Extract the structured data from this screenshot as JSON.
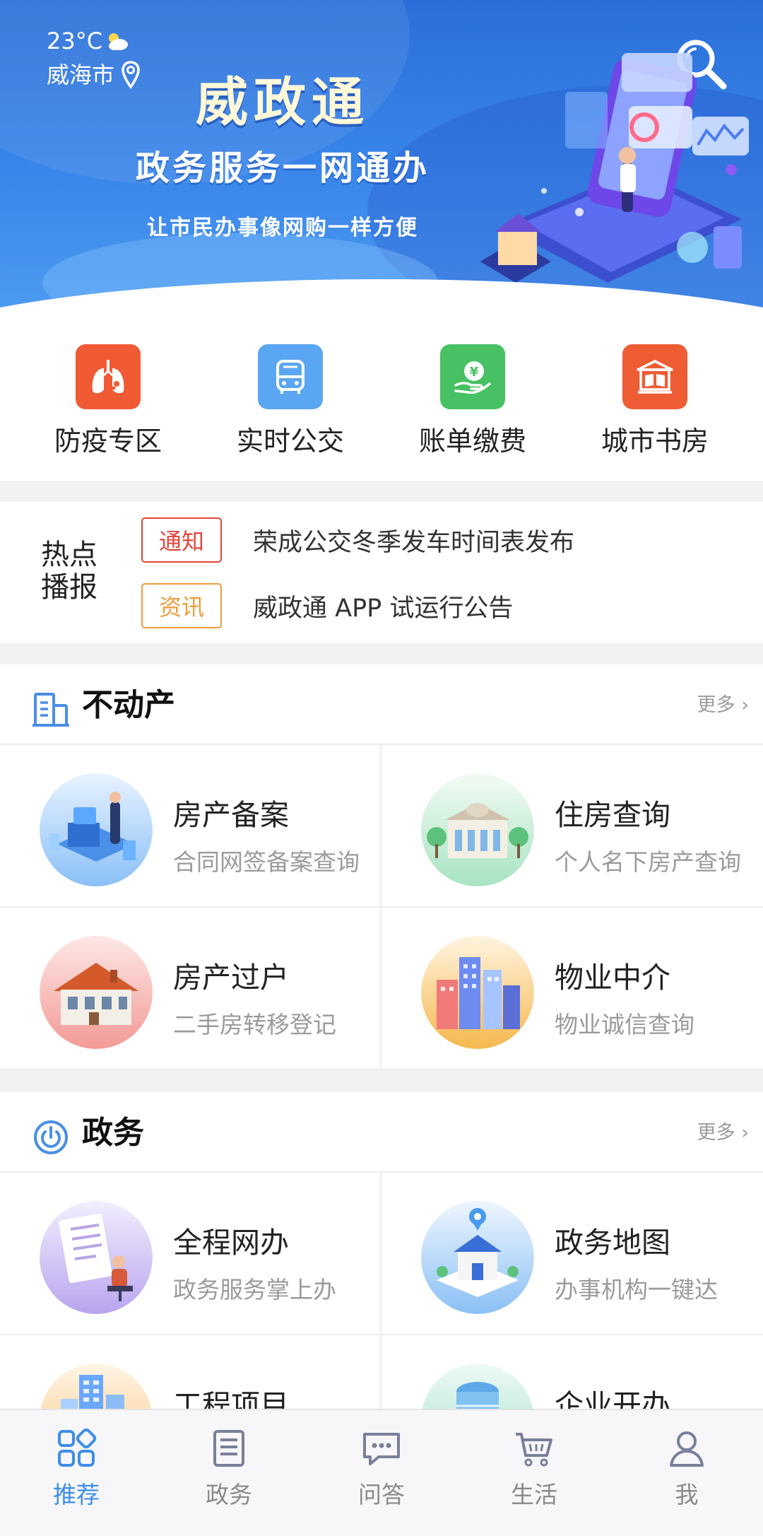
{
  "weather": {
    "temperature": "23°C",
    "city": "威海市"
  },
  "banner": {
    "app_name": "威政通",
    "slogan": "政务服务一网通办",
    "tagline": "让市民办事像网购一样方便"
  },
  "quick_menu": [
    {
      "label": "防疫专区",
      "icon": "lungs-icon",
      "color": "#ef5a35"
    },
    {
      "label": "实时公交",
      "icon": "bus-icon",
      "color": "#5aa6f2"
    },
    {
      "label": "账单缴费",
      "icon": "payment-icon",
      "color": "#47c163"
    },
    {
      "label": "城市书房",
      "icon": "library-icon",
      "color": "#ee5c34"
    }
  ],
  "hot_news": {
    "title_line1": "热点",
    "title_line2": "播报",
    "items": [
      {
        "tag": "通知",
        "text": "荣成公交冬季发车时间表发布",
        "color": "#e2453c"
      },
      {
        "tag": "资讯",
        "text": "威政通 APP 试运行公告",
        "color": "#ef9b3a"
      }
    ]
  },
  "real_estate": {
    "title": "不动产",
    "more": "更多",
    "items": [
      {
        "title": "房产备案",
        "subtitle": "合同网签备案查询"
      },
      {
        "title": "住房查询",
        "subtitle": "个人名下房产查询"
      },
      {
        "title": "房产过户",
        "subtitle": "二手房转移登记"
      },
      {
        "title": "物业中介",
        "subtitle": "物业诚信查询"
      }
    ]
  },
  "government": {
    "title": "政务",
    "more": "更多",
    "items": [
      {
        "title": "全程网办",
        "subtitle": "政务服务掌上办"
      },
      {
        "title": "政务地图",
        "subtitle": "办事机构一键达"
      },
      {
        "title": "工程项目",
        "subtitle": ""
      },
      {
        "title": "企业开办",
        "subtitle": ""
      }
    ]
  },
  "tabbar": {
    "active_color": "#3e8ee8",
    "items": [
      {
        "label": "推荐",
        "icon": "recommend-icon",
        "active": true
      },
      {
        "label": "政务",
        "icon": "document-list-icon",
        "active": false
      },
      {
        "label": "问答",
        "icon": "chat-bubble-icon",
        "active": false
      },
      {
        "label": "生活",
        "icon": "shopping-cart-icon",
        "active": false
      },
      {
        "label": "我",
        "icon": "user-icon",
        "active": false
      }
    ]
  }
}
